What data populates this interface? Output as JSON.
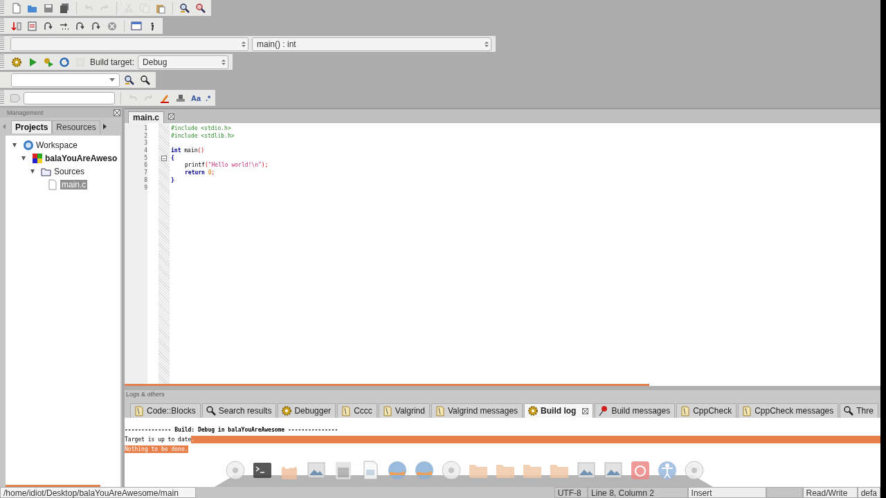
{
  "toolbars": {
    "main": [
      {
        "kind": "new",
        "disabled": false
      },
      {
        "kind": "open",
        "disabled": false
      },
      {
        "kind": "save",
        "disabled": false
      },
      {
        "kind": "save-all",
        "disabled": false
      },
      {
        "kind": "sep"
      },
      {
        "kind": "undo",
        "disabled": true
      },
      {
        "kind": "redo",
        "disabled": true
      },
      {
        "kind": "sep"
      },
      {
        "kind": "cut",
        "disabled": true
      },
      {
        "kind": "copy",
        "disabled": true
      },
      {
        "kind": "paste",
        "disabled": false
      },
      {
        "kind": "sep"
      },
      {
        "kind": "find",
        "disabled": false
      },
      {
        "kind": "replace",
        "disabled": false
      }
    ],
    "debug": [
      {
        "kind": "step-down",
        "disabled": false
      },
      {
        "kind": "list",
        "disabled": false
      },
      {
        "kind": "curve",
        "disabled": false
      },
      {
        "kind": "dots",
        "disabled": false
      },
      {
        "kind": "curve",
        "disabled": false
      },
      {
        "kind": "curve",
        "disabled": false
      },
      {
        "kind": "stop",
        "disabled": false
      },
      {
        "kind": "sep"
      },
      {
        "kind": "window",
        "disabled": false
      },
      {
        "kind": "info",
        "disabled": false
      }
    ],
    "code_completion": {
      "symbol": "main() : int"
    },
    "build": {
      "buttons": [
        {
          "kind": "gear",
          "disabled": false
        },
        {
          "kind": "play",
          "disabled": false
        },
        {
          "kind": "gear-play",
          "disabled": false
        },
        {
          "kind": "rebuild",
          "disabled": false
        },
        {
          "kind": "abort",
          "disabled": true
        }
      ],
      "target_label": "Build target:",
      "target": "Debug"
    },
    "search_buttons": [
      {
        "kind": "find",
        "disabled": false
      },
      {
        "kind": "search",
        "disabled": false
      }
    ],
    "edit": {
      "buttons": [
        {
          "kind": "back",
          "disabled": true
        },
        {
          "kind": "forward",
          "disabled": true
        },
        {
          "kind": "highlight",
          "disabled": false
        },
        {
          "kind": "select",
          "disabled": false
        },
        {
          "kind": "text",
          "label": "Aa",
          "disabled": false
        },
        {
          "kind": "text",
          "label": ".*",
          "disabled": false
        }
      ]
    }
  },
  "management": {
    "title": "Management",
    "tabs": [
      {
        "label": "Projects",
        "selected": true
      },
      {
        "label": "Resources",
        "selected": false
      }
    ],
    "tree": [
      {
        "label": "Workspace",
        "kind": "workspace",
        "expanded": true,
        "selected": false,
        "children": [
          {
            "label": "balaYouAreAweso",
            "kind": "project",
            "expanded": true,
            "selected": false,
            "children": [
              {
                "label": "Sources",
                "kind": "folder",
                "expanded": true,
                "selected": false,
                "children": [
                  {
                    "label": "main.c",
                    "kind": "file",
                    "selected": true
                  }
                ]
              }
            ]
          }
        ]
      }
    ]
  },
  "editor": {
    "tabs": [
      {
        "label": "main.c",
        "selected": true
      }
    ],
    "lines": [
      {
        "number": "1",
        "tokens": [
          {
            "kind": "pre",
            "text": "#include <stdio.h>"
          }
        ]
      },
      {
        "number": "2",
        "tokens": [
          {
            "kind": "pre",
            "text": "#include <stdlib.h>"
          }
        ]
      },
      {
        "number": "3"
      },
      {
        "number": "4",
        "tokens": [
          {
            "kind": "keyword",
            "text": "int"
          },
          {
            "kind": "plain",
            "text": " main"
          },
          {
            "kind": "op",
            "text": "()"
          }
        ]
      },
      {
        "number": "5",
        "fold": true,
        "tokens": [
          {
            "kind": "brace",
            "text": "{"
          }
        ]
      },
      {
        "number": "6",
        "indent": true,
        "tokens": [
          {
            "kind": "plain",
            "text": "printf"
          },
          {
            "kind": "op",
            "text": "("
          },
          {
            "kind": "string",
            "text": "\"Hello world!\\n\""
          },
          {
            "kind": "op",
            "text": ");"
          }
        ]
      },
      {
        "number": "7",
        "indent": true,
        "tokens": [
          {
            "kind": "keyword",
            "text": "return"
          },
          {
            "kind": "number",
            "text": " 0"
          },
          {
            "kind": "op",
            "text": ";"
          }
        ]
      },
      {
        "number": "8",
        "tokens": [
          {
            "kind": "brace",
            "text": "}"
          }
        ]
      },
      {
        "number": "9"
      }
    ]
  },
  "logs": {
    "title": "Logs & others",
    "tabs": [
      {
        "label": "Code::Blocks",
        "kind": "note",
        "selected": false
      },
      {
        "label": "Search results",
        "kind": "search",
        "selected": false
      },
      {
        "label": "Debugger",
        "kind": "gear",
        "selected": false
      },
      {
        "label": "Cccc",
        "kind": "note",
        "selected": false
      },
      {
        "label": "Valgrind",
        "kind": "note",
        "selected": false
      },
      {
        "label": "Valgrind messages",
        "kind": "note",
        "selected": false
      },
      {
        "label": "Build log",
        "kind": "gear",
        "selected": true
      },
      {
        "label": "Build messages",
        "kind": "pin",
        "selected": false
      },
      {
        "label": "CppCheck",
        "kind": "note",
        "selected": false
      },
      {
        "label": "CppCheck messages",
        "kind": "note",
        "selected": false
      },
      {
        "label": "Thre",
        "kind": "search",
        "selected": false
      }
    ],
    "lines": [
      {
        "kind": "header",
        "segments": [
          {
            "text": "-------------- Build: Debug in balaYouAreAwesome ---------------",
            "selected": false
          }
        ]
      },
      {
        "kind": "plain",
        "eol_selected": true,
        "segments": [
          {
            "text": "Target is up to date",
            "selected": false
          },
          {
            "text": ".",
            "selected": true
          }
        ]
      },
      {
        "kind": "plain",
        "eol_selected": false,
        "segments": [
          {
            "text": "Nothing to be done.",
            "selected": true
          }
        ]
      }
    ]
  },
  "status_bar": {
    "path": "/home/idiot/Desktop/balaYouAreAwesome/main",
    "encoding": "UTF-8",
    "position": "Line 8, Column 2",
    "mode": "Insert",
    "access": "Read/Write",
    "extra": "defa"
  },
  "dock": [
    {
      "kind": "disc"
    },
    {
      "kind": "terminal"
    },
    {
      "kind": "box"
    },
    {
      "kind": "image"
    },
    {
      "kind": "grid"
    },
    {
      "kind": "doc"
    },
    {
      "kind": "globe"
    },
    {
      "kind": "globe"
    },
    {
      "kind": "disc"
    },
    {
      "kind": "folder"
    },
    {
      "kind": "folder"
    },
    {
      "kind": "folder"
    },
    {
      "kind": "folder"
    },
    {
      "kind": "image"
    },
    {
      "kind": "image"
    },
    {
      "kind": "power"
    },
    {
      "kind": "person"
    },
    {
      "kind": "disc"
    }
  ]
}
